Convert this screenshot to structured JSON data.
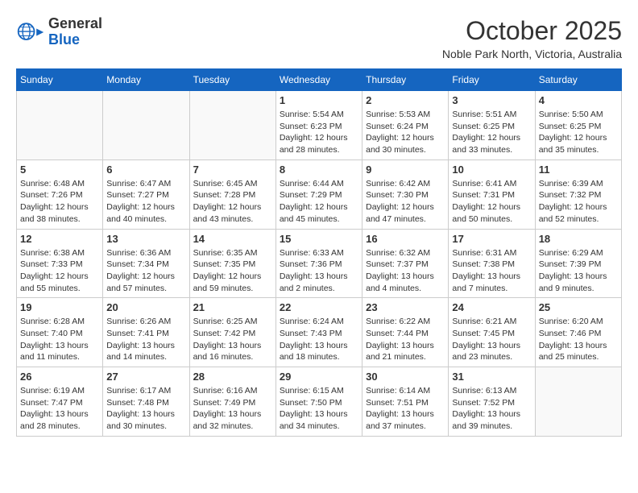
{
  "header": {
    "logo_line1": "General",
    "logo_line2": "Blue",
    "month_year": "October 2025",
    "location": "Noble Park North, Victoria, Australia"
  },
  "calendar": {
    "days_of_week": [
      "Sunday",
      "Monday",
      "Tuesday",
      "Wednesday",
      "Thursday",
      "Friday",
      "Saturday"
    ],
    "weeks": [
      [
        {
          "day": "",
          "info": ""
        },
        {
          "day": "",
          "info": ""
        },
        {
          "day": "",
          "info": ""
        },
        {
          "day": "1",
          "info": "Sunrise: 5:54 AM\nSunset: 6:23 PM\nDaylight: 12 hours\nand 28 minutes."
        },
        {
          "day": "2",
          "info": "Sunrise: 5:53 AM\nSunset: 6:24 PM\nDaylight: 12 hours\nand 30 minutes."
        },
        {
          "day": "3",
          "info": "Sunrise: 5:51 AM\nSunset: 6:25 PM\nDaylight: 12 hours\nand 33 minutes."
        },
        {
          "day": "4",
          "info": "Sunrise: 5:50 AM\nSunset: 6:25 PM\nDaylight: 12 hours\nand 35 minutes."
        }
      ],
      [
        {
          "day": "5",
          "info": "Sunrise: 6:48 AM\nSunset: 7:26 PM\nDaylight: 12 hours\nand 38 minutes."
        },
        {
          "day": "6",
          "info": "Sunrise: 6:47 AM\nSunset: 7:27 PM\nDaylight: 12 hours\nand 40 minutes."
        },
        {
          "day": "7",
          "info": "Sunrise: 6:45 AM\nSunset: 7:28 PM\nDaylight: 12 hours\nand 43 minutes."
        },
        {
          "day": "8",
          "info": "Sunrise: 6:44 AM\nSunset: 7:29 PM\nDaylight: 12 hours\nand 45 minutes."
        },
        {
          "day": "9",
          "info": "Sunrise: 6:42 AM\nSunset: 7:30 PM\nDaylight: 12 hours\nand 47 minutes."
        },
        {
          "day": "10",
          "info": "Sunrise: 6:41 AM\nSunset: 7:31 PM\nDaylight: 12 hours\nand 50 minutes."
        },
        {
          "day": "11",
          "info": "Sunrise: 6:39 AM\nSunset: 7:32 PM\nDaylight: 12 hours\nand 52 minutes."
        }
      ],
      [
        {
          "day": "12",
          "info": "Sunrise: 6:38 AM\nSunset: 7:33 PM\nDaylight: 12 hours\nand 55 minutes."
        },
        {
          "day": "13",
          "info": "Sunrise: 6:36 AM\nSunset: 7:34 PM\nDaylight: 12 hours\nand 57 minutes."
        },
        {
          "day": "14",
          "info": "Sunrise: 6:35 AM\nSunset: 7:35 PM\nDaylight: 12 hours\nand 59 minutes."
        },
        {
          "day": "15",
          "info": "Sunrise: 6:33 AM\nSunset: 7:36 PM\nDaylight: 13 hours\nand 2 minutes."
        },
        {
          "day": "16",
          "info": "Sunrise: 6:32 AM\nSunset: 7:37 PM\nDaylight: 13 hours\nand 4 minutes."
        },
        {
          "day": "17",
          "info": "Sunrise: 6:31 AM\nSunset: 7:38 PM\nDaylight: 13 hours\nand 7 minutes."
        },
        {
          "day": "18",
          "info": "Sunrise: 6:29 AM\nSunset: 7:39 PM\nDaylight: 13 hours\nand 9 minutes."
        }
      ],
      [
        {
          "day": "19",
          "info": "Sunrise: 6:28 AM\nSunset: 7:40 PM\nDaylight: 13 hours\nand 11 minutes."
        },
        {
          "day": "20",
          "info": "Sunrise: 6:26 AM\nSunset: 7:41 PM\nDaylight: 13 hours\nand 14 minutes."
        },
        {
          "day": "21",
          "info": "Sunrise: 6:25 AM\nSunset: 7:42 PM\nDaylight: 13 hours\nand 16 minutes."
        },
        {
          "day": "22",
          "info": "Sunrise: 6:24 AM\nSunset: 7:43 PM\nDaylight: 13 hours\nand 18 minutes."
        },
        {
          "day": "23",
          "info": "Sunrise: 6:22 AM\nSunset: 7:44 PM\nDaylight: 13 hours\nand 21 minutes."
        },
        {
          "day": "24",
          "info": "Sunrise: 6:21 AM\nSunset: 7:45 PM\nDaylight: 13 hours\nand 23 minutes."
        },
        {
          "day": "25",
          "info": "Sunrise: 6:20 AM\nSunset: 7:46 PM\nDaylight: 13 hours\nand 25 minutes."
        }
      ],
      [
        {
          "day": "26",
          "info": "Sunrise: 6:19 AM\nSunset: 7:47 PM\nDaylight: 13 hours\nand 28 minutes."
        },
        {
          "day": "27",
          "info": "Sunrise: 6:17 AM\nSunset: 7:48 PM\nDaylight: 13 hours\nand 30 minutes."
        },
        {
          "day": "28",
          "info": "Sunrise: 6:16 AM\nSunset: 7:49 PM\nDaylight: 13 hours\nand 32 minutes."
        },
        {
          "day": "29",
          "info": "Sunrise: 6:15 AM\nSunset: 7:50 PM\nDaylight: 13 hours\nand 34 minutes."
        },
        {
          "day": "30",
          "info": "Sunrise: 6:14 AM\nSunset: 7:51 PM\nDaylight: 13 hours\nand 37 minutes."
        },
        {
          "day": "31",
          "info": "Sunrise: 6:13 AM\nSunset: 7:52 PM\nDaylight: 13 hours\nand 39 minutes."
        },
        {
          "day": "",
          "info": ""
        }
      ]
    ]
  }
}
